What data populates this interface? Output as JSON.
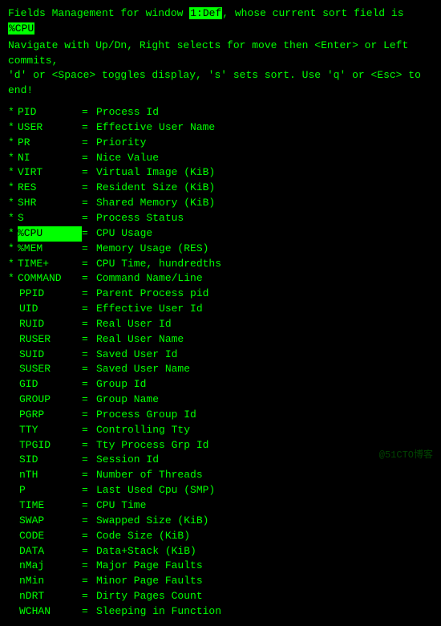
{
  "header": {
    "prefix": "Fields Management for window ",
    "window_id": "1:Def",
    "middle": ", whose current sort field is ",
    "sort_field": "%CPU",
    "nav_line1": "   Navigate with Up/Dn, Right selects for move then <Enter> or Left commits,",
    "nav_line2": "   'd' or <Space> toggles display, 's' sets sort.  Use 'q' or <Esc> to end!"
  },
  "fields": [
    {
      "star": "*",
      "name": "PID",
      "desc": "Process Id",
      "selected": false
    },
    {
      "star": "*",
      "name": "USER",
      "desc": "Effective User Name",
      "selected": false
    },
    {
      "star": "*",
      "name": "PR",
      "desc": "Priority",
      "selected": false
    },
    {
      "star": "*",
      "name": "NI",
      "desc": "Nice Value",
      "selected": false
    },
    {
      "star": "*",
      "name": "VIRT",
      "desc": "Virtual Image (KiB)",
      "selected": false
    },
    {
      "star": "*",
      "name": "RES",
      "desc": "Resident Size (KiB)",
      "selected": false
    },
    {
      "star": "*",
      "name": "SHR",
      "desc": "Shared Memory (KiB)",
      "selected": false
    },
    {
      "star": "*",
      "name": "S",
      "desc": "Process Status",
      "selected": false
    },
    {
      "star": "*",
      "name": "%CPU",
      "desc": "CPU Usage",
      "selected": true
    },
    {
      "star": "*",
      "name": "%MEM",
      "desc": "Memory Usage (RES)",
      "selected": false
    },
    {
      "star": "*",
      "name": "TIME+",
      "desc": "CPU Time, hundredths",
      "selected": false
    },
    {
      "star": "*",
      "name": "COMMAND",
      "desc": "Command Name/Line",
      "selected": false
    },
    {
      "star": " ",
      "name": "PPID",
      "desc": "Parent Process pid",
      "selected": false
    },
    {
      "star": " ",
      "name": "UID",
      "desc": "Effective User Id",
      "selected": false
    },
    {
      "star": " ",
      "name": "RUID",
      "desc": "Real User Id",
      "selected": false
    },
    {
      "star": " ",
      "name": "RUSER",
      "desc": "Real User Name",
      "selected": false
    },
    {
      "star": " ",
      "name": "SUID",
      "desc": "Saved User Id",
      "selected": false
    },
    {
      "star": " ",
      "name": "SUSER",
      "desc": "Saved User Name",
      "selected": false
    },
    {
      "star": " ",
      "name": "GID",
      "desc": "Group Id",
      "selected": false
    },
    {
      "star": " ",
      "name": "GROUP",
      "desc": "Group Name",
      "selected": false
    },
    {
      "star": " ",
      "name": "PGRP",
      "desc": "Process Group Id",
      "selected": false
    },
    {
      "star": " ",
      "name": "TTY",
      "desc": "Controlling Tty",
      "selected": false
    },
    {
      "star": " ",
      "name": "TPGID",
      "desc": "Tty Process Grp Id",
      "selected": false
    },
    {
      "star": " ",
      "name": "SID",
      "desc": "Session Id",
      "selected": false
    },
    {
      "star": " ",
      "name": "nTH",
      "desc": "Number of Threads",
      "selected": false
    },
    {
      "star": " ",
      "name": "P",
      "desc": "Last Used Cpu (SMP)",
      "selected": false
    },
    {
      "star": " ",
      "name": "TIME",
      "desc": "CPU Time",
      "selected": false
    },
    {
      "star": " ",
      "name": "SWAP",
      "desc": "Swapped Size (KiB)",
      "selected": false
    },
    {
      "star": " ",
      "name": "CODE",
      "desc": "Code Size (KiB)",
      "selected": false
    },
    {
      "star": " ",
      "name": "DATA",
      "desc": "Data+Stack (KiB)",
      "selected": false
    },
    {
      "star": " ",
      "name": "nMaj",
      "desc": "Major Page Faults",
      "selected": false
    },
    {
      "star": " ",
      "name": "nMin",
      "desc": "Minor Page Faults",
      "selected": false
    },
    {
      "star": " ",
      "name": "nDRT",
      "desc": "Dirty Pages Count",
      "selected": false
    },
    {
      "star": " ",
      "name": "WCHAN",
      "desc": "Sleeping in Function",
      "selected": false
    }
  ],
  "watermark": "@51CTO博客"
}
